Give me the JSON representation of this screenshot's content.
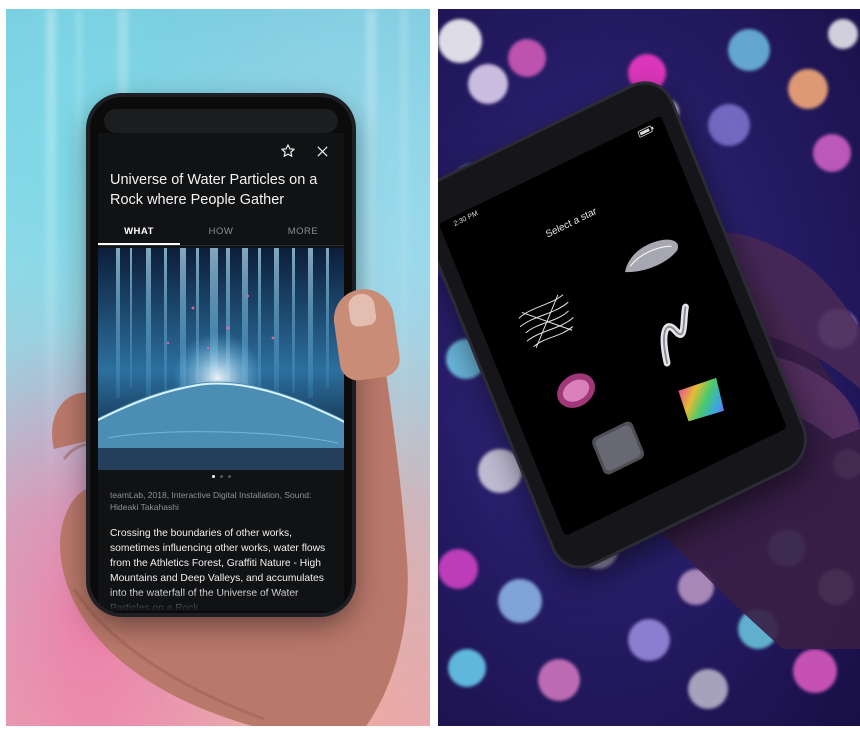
{
  "left_phone": {
    "title": "Universe of Water Particles on a Rock where People Gather",
    "icons": [
      "star-outline-icon",
      "close-icon"
    ],
    "tabs": [
      {
        "label": "WHAT",
        "active": true
      },
      {
        "label": "HOW",
        "active": false
      },
      {
        "label": "MORE",
        "active": false
      }
    ],
    "carousel": {
      "pages": 3,
      "current": 1
    },
    "credits": "teamLab, 2018, Interactive Digital Installation, Sound: Hideaki Takahashi",
    "description": "Crossing the boundaries of other works, sometimes influencing other works, water flows from the Athletics Forest, Graffiti Nature - High Mountains and Deep Valleys, and accumulates into the waterfall of the Universe of Water Particles on a Rock"
  },
  "right_phone": {
    "status_time": "2:30 PM",
    "prompt": "Select a star",
    "star_options": [
      "scribble-star",
      "silver-cloud-star",
      "pink-orb-star",
      "silver-ribbon-star",
      "grey-noise-star",
      "rainbow-prism-star"
    ]
  },
  "colors": {
    "phone_screen": "#111214",
    "text_primary": "#f2f2f2",
    "text_secondary": "#8f9095",
    "right_background": "#241a62"
  }
}
